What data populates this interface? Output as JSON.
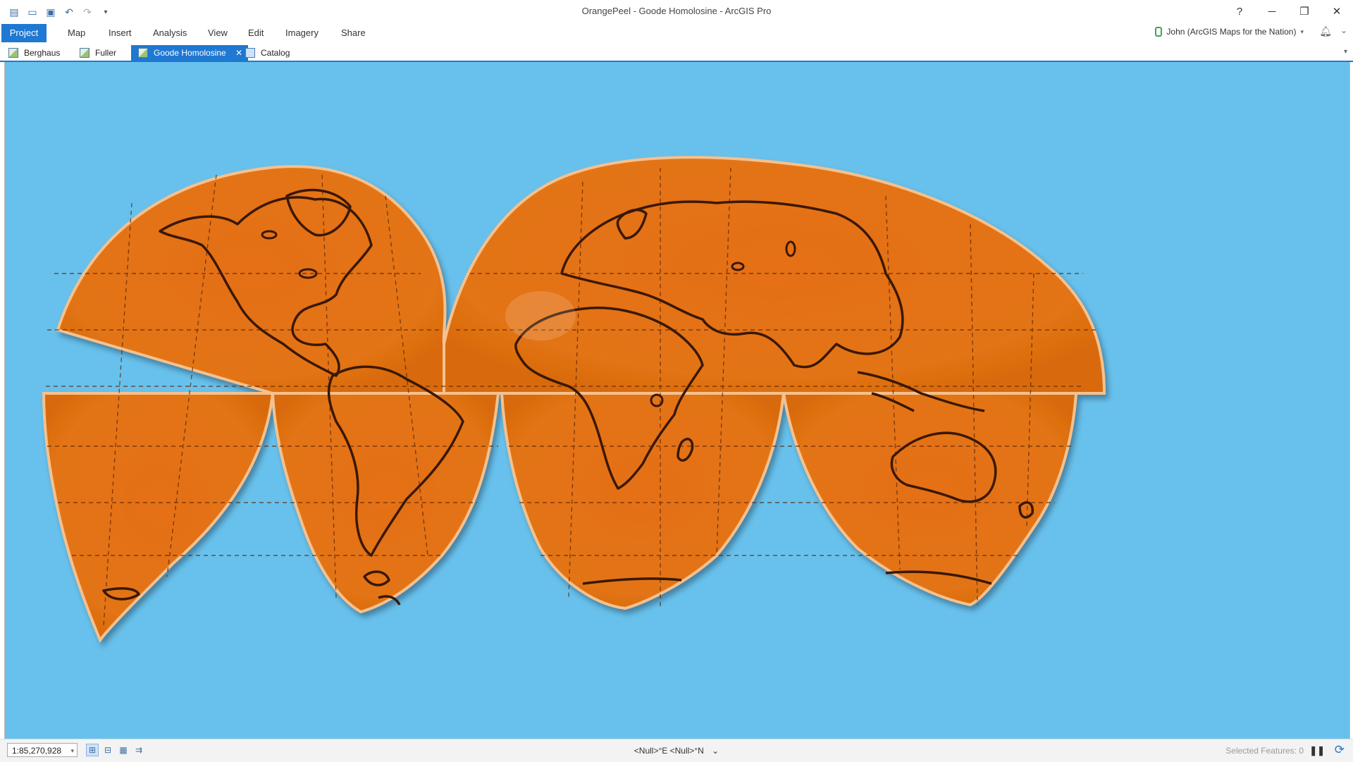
{
  "window": {
    "title": "OrangePeel - Goode Homolosine - ArcGIS Pro",
    "help": "?",
    "minimize": "─",
    "restore": "❐",
    "close": "✕"
  },
  "quick_access": [
    "new-project-icon",
    "open-project-icon",
    "save-project-icon",
    "undo-icon",
    "redo-icon",
    "customize-icon"
  ],
  "ribbon": {
    "tabs": [
      "Project",
      "Map",
      "Insert",
      "Analysis",
      "View",
      "Edit",
      "Imagery",
      "Share"
    ],
    "active_tab": "Project",
    "user": "John (ArcGIS Maps for the Nation)",
    "user_caret": "▾",
    "bell": "🔔",
    "collapse": "⌄"
  },
  "views": {
    "tabs": [
      {
        "label": "Berghaus",
        "icon": "map-view-icon"
      },
      {
        "label": "Fuller",
        "icon": "map-view-icon"
      },
      {
        "label": "Goode Homolosine",
        "icon": "map-view-icon",
        "active": true
      },
      {
        "label": "Catalog",
        "icon": "catalog-icon"
      }
    ],
    "close_glyph": "✕",
    "dropdown": "▾"
  },
  "map": {
    "ocean_color": "#68c1ec",
    "land_color": "#e8731a",
    "projection": "Goode Homolosine"
  },
  "status": {
    "scale": "1:85,270,928",
    "scale_caret": "▾",
    "coordinates": "<Null>°E <Null>°N",
    "coords_caret": "⌄",
    "selected": "Selected Features: 0",
    "pause": "❚❚",
    "refresh": "⟳"
  }
}
